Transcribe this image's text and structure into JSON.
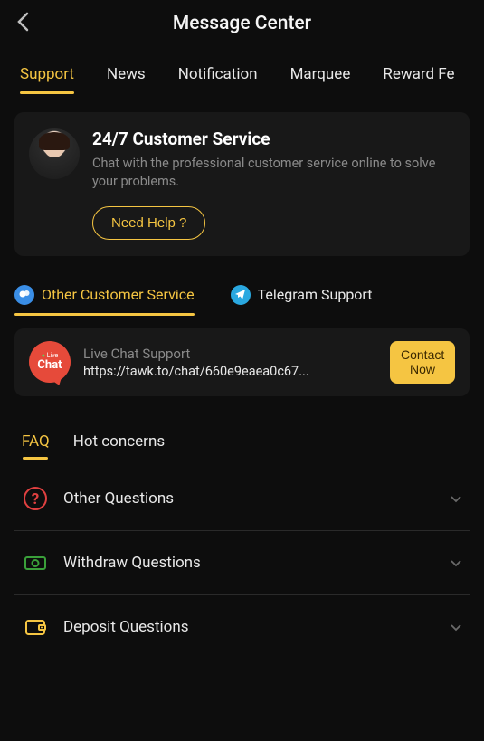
{
  "header": {
    "title": "Message Center"
  },
  "tabs": [
    {
      "label": "Support",
      "active": true
    },
    {
      "label": "News",
      "active": false
    },
    {
      "label": "Notification",
      "active": false
    },
    {
      "label": "Marquee",
      "active": false
    },
    {
      "label": "Reward Fe",
      "active": false
    }
  ],
  "service": {
    "title": "24/7 Customer Service",
    "desc": "Chat with the professional customer service online to solve your problems.",
    "button": "Need Help ?"
  },
  "subtabs": [
    {
      "label": "Other Customer Service",
      "active": true
    },
    {
      "label": "Telegram Support",
      "active": false
    }
  ],
  "livechat": {
    "logo_top": "Live",
    "logo_bottom": "Chat",
    "title": "Live Chat Support",
    "url": "https://tawk.to/chat/660e9eaea0c67...",
    "button": "Contact Now"
  },
  "faqtabs": [
    {
      "label": "FAQ",
      "active": true
    },
    {
      "label": "Hot concerns",
      "active": false
    }
  ],
  "faqs": [
    {
      "label": "Other Questions",
      "icon": "question",
      "color": "#e04040"
    },
    {
      "label": "Withdraw Questions",
      "icon": "cash",
      "color": "#3aa03a"
    },
    {
      "label": "Deposit Questions",
      "icon": "wallet",
      "color": "#f5c542"
    }
  ]
}
